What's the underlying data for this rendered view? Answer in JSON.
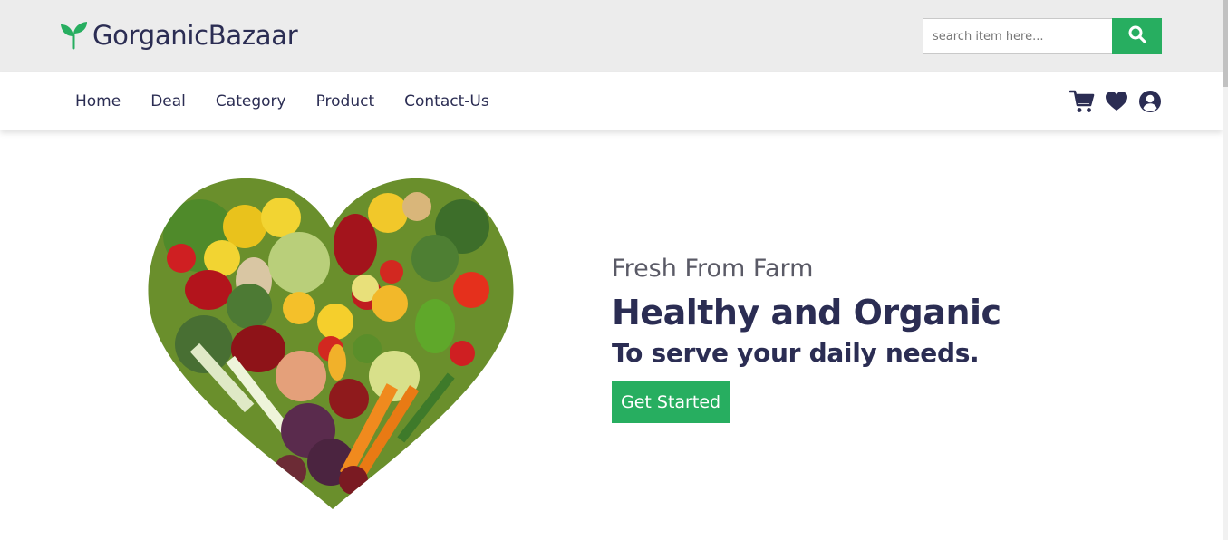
{
  "brand": {
    "name": "GorganicBazaar",
    "logo_icon": "sprout-icon",
    "color": "#27ae60"
  },
  "search": {
    "placeholder": "search item here...",
    "value": "",
    "icon": "search-icon"
  },
  "nav": {
    "links": [
      "Home",
      "Deal",
      "Category",
      "Product",
      "Contact-Us"
    ],
    "icons": [
      "cart-icon",
      "heart-icon",
      "user-icon"
    ]
  },
  "hero": {
    "eyebrow": "Fresh From Farm",
    "headline": "Healthy and Organic",
    "subhead": "To serve your daily needs.",
    "cta_label": "Get Started",
    "image": "heart-shaped-vegetables-image"
  },
  "colors": {
    "accent": "#27ae60",
    "text_dark": "#2b2d53",
    "topbar_bg": "#ececec"
  }
}
